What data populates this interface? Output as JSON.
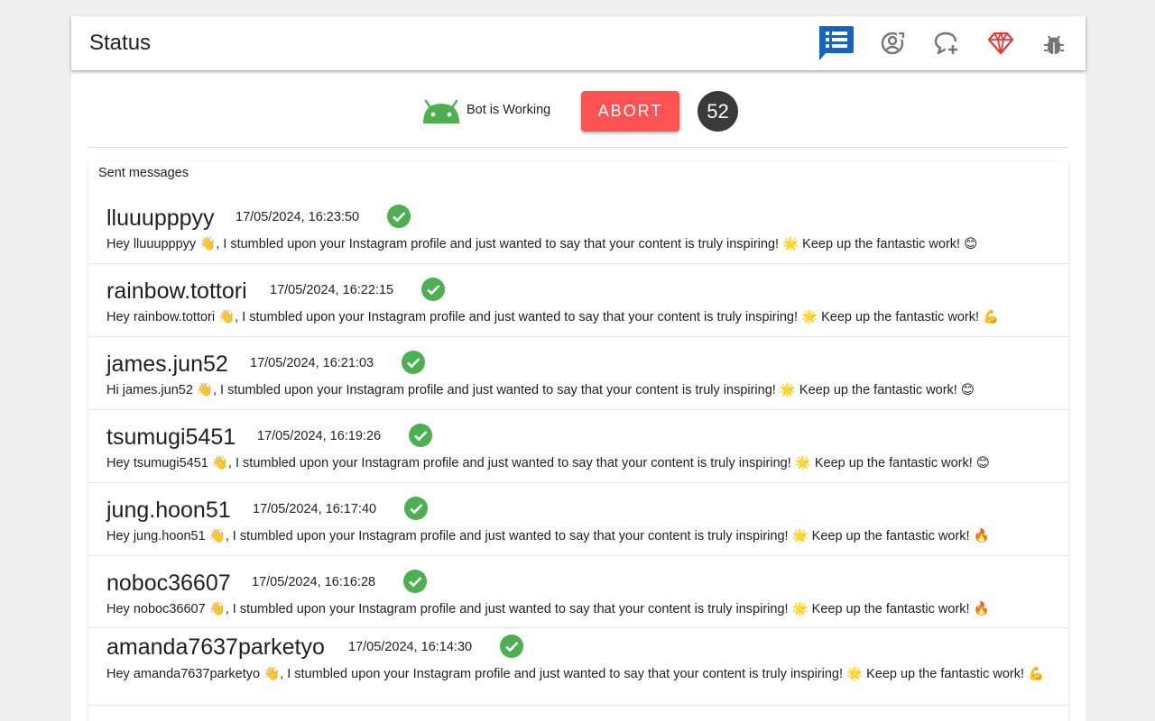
{
  "header": {
    "title": "Status",
    "icons": [
      "list-chat-icon",
      "account-sync-icon",
      "chat-plus-icon",
      "diamond-icon",
      "bug-icon"
    ],
    "active_icon_color": "#1565c0",
    "icon_color": "#757575",
    "diamond_color": "#e53935"
  },
  "status": {
    "bot_label": "Bot is Working",
    "abort_label": "ABORT",
    "count": "52",
    "bot_color": "#4caf50",
    "abort_color": "#ff5252"
  },
  "sent": {
    "title": "Sent messages",
    "messages": [
      {
        "username": "lluuupppyy",
        "timestamp": "17/05/2024, 16:23:50",
        "text": "Hey lluuupppyy 👋, I stumbled upon your Instagram profile and just wanted to say that your content is truly inspiring! 🌟 Keep up the fantastic work! 😊"
      },
      {
        "username": "rainbow.tottori",
        "timestamp": "17/05/2024, 16:22:15",
        "text": "Hey rainbow.tottori 👋, I stumbled upon your Instagram profile and just wanted to say that your content is truly inspiring! 🌟 Keep up the fantastic work! 💪"
      },
      {
        "username": "james.jun52",
        "timestamp": "17/05/2024, 16:21:03",
        "text": "Hi james.jun52 👋, I stumbled upon your Instagram profile and just wanted to say that your content is truly inspiring! 🌟 Keep up the fantastic work! 😊"
      },
      {
        "username": "tsumugi5451",
        "timestamp": "17/05/2024, 16:19:26",
        "text": "Hey tsumugi5451 👋, I stumbled upon your Instagram profile and just wanted to say that your content is truly inspiring! 🌟 Keep up the fantastic work! 😊"
      },
      {
        "username": "jung.hoon51",
        "timestamp": "17/05/2024, 16:17:40",
        "text": "Hey jung.hoon51 👋, I stumbled upon your Instagram profile and just wanted to say that your content is truly inspiring! 🌟 Keep up the fantastic work! 🔥"
      },
      {
        "username": "noboc36607",
        "timestamp": "17/05/2024, 16:16:28",
        "text": "Hey noboc36607 👋, I stumbled upon your Instagram profile and just wanted to say that your content is truly inspiring! 🌟 Keep up the fantastic work! 🔥"
      },
      {
        "username": "amanda7637parketyo",
        "timestamp": "17/05/2024, 16:14:30",
        "text": "Hey amanda7637parketyo 👋, I stumbled upon your Instagram profile and just wanted to say that your content is truly inspiring! 🌟 Keep up the fantastic work! 💪"
      }
    ],
    "check_color": "#4caf50"
  }
}
